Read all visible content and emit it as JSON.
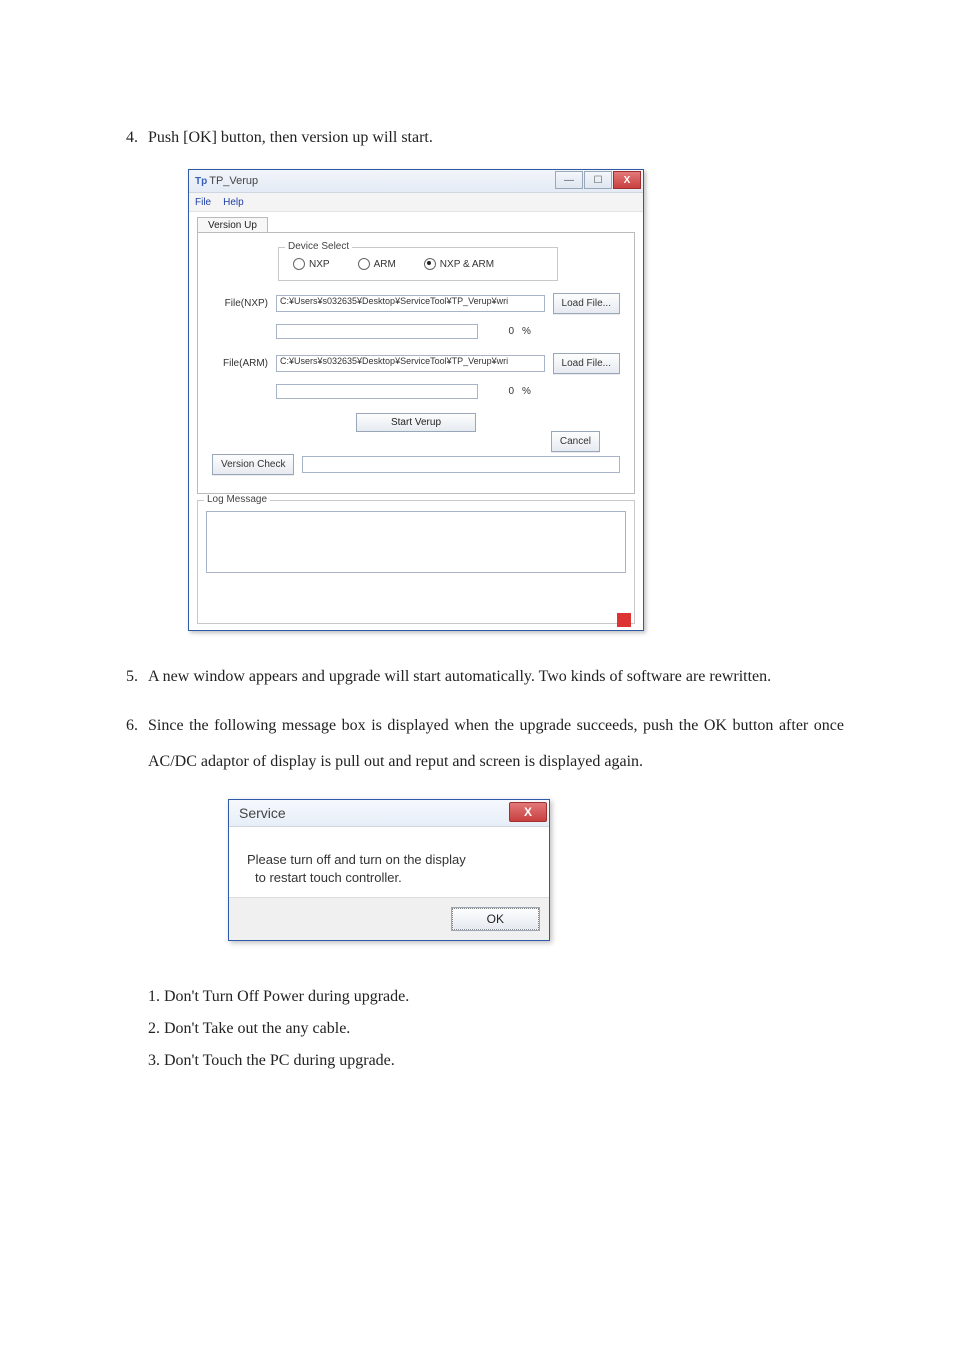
{
  "items": {
    "i4": {
      "num": "4.",
      "text": "Push [OK] button, then version up will start."
    },
    "i5": {
      "num": "5.",
      "text": "A new window appears and upgrade will start automatically. Two kinds of software are rewritten."
    },
    "i6": {
      "num": "6.",
      "text": "Since the following message box is displayed when the upgrade succeeds, push the OK button after once AC/DC adaptor of display is pull out and reput and screen is displayed again."
    }
  },
  "notes": {
    "n1": "1. Don't Turn Off Power during upgrade.",
    "n2": "2. Don't Take out the any cable.",
    "n3": "3. Don't Touch the PC during upgrade."
  },
  "verup": {
    "app_prefix": "Tp",
    "title": "TP_Verup",
    "menu": {
      "file": "File",
      "help": "Help"
    },
    "tab": "Version Up",
    "device_group": {
      "title": "Device Select",
      "nxp": "NXP",
      "arm": "ARM",
      "both": "NXP & ARM"
    },
    "file_nxp_label": "File(NXP)",
    "file_arm_label": "File(ARM)",
    "path_nxp": "C:¥Users¥s032635¥Desktop¥ServiceTool¥TP_Verup¥wri",
    "path_arm": "C:¥Users¥s032635¥Desktop¥ServiceTool¥TP_Verup¥wri",
    "load_file": "Load File...",
    "pct0": "0",
    "pct_sign": "%",
    "start": "Start Verup",
    "cancel": "Cancel",
    "version_check": "Version Check",
    "log_title": "Log Message"
  },
  "service": {
    "title": "Service",
    "msg1": "Please turn off and turn on the display",
    "msg2": "to restart touch controller.",
    "ok": "OK"
  }
}
